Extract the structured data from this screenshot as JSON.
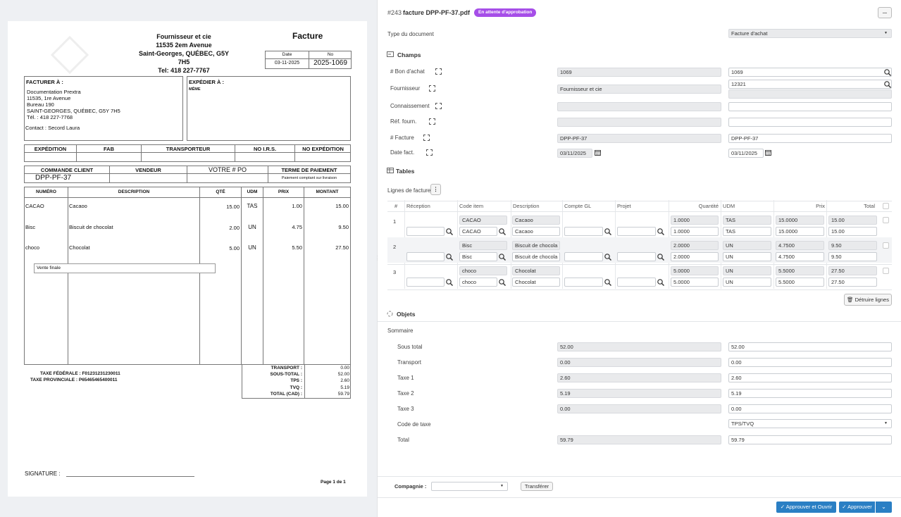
{
  "pdf": {
    "supplier": {
      "name": "Fournisseur et cie",
      "address": "11535 2em Avenue",
      "city": "Saint-Georges, QUÉBEC, G5Y 7H5",
      "phone": "Tel: 418 227-7767"
    },
    "title": "Facture",
    "date_label": "Date",
    "no_label": "No",
    "date": "03-11-2025",
    "no": "2025-1069",
    "bill_to_label": "FACTURER À :",
    "bill_to": [
      "Documentation Prextra",
      "11535, 1re Avenue",
      "Bureau 190",
      "SAINT-GEORGES, QUÉBEC, G5Y 7H5",
      "Tél. : 418 227-7768"
    ],
    "contact": "Contact : Secord Laura",
    "ship_to_label": "EXPÉDIER À :",
    "ship_to": "MÊME",
    "row1_headers": [
      "EXPÉDITION",
      "FAB",
      "TRANSPORTEUR",
      "NO I.R.S.",
      "NO EXPÉDITION"
    ],
    "row2_headers": [
      "COMMANDE CLIENT",
      "VENDEUR",
      "VOTRE # PO",
      "TERME DE PAIEMENT"
    ],
    "client_order": "DPP-PF-37",
    "payment_term": "Paiement comptant sur livraison",
    "item_headers": [
      "NUMÉRO",
      "DESCRIPTION",
      "QTÉ",
      "UDM",
      "PRIX",
      "MONTANT"
    ],
    "items": [
      {
        "num": "CACAO",
        "desc": "Cacaoo",
        "qty": "15.00",
        "udm": "TAS",
        "price": "1.00",
        "amount": "15.00"
      },
      {
        "num": "Bisc",
        "desc": "Biscuit de chocolat",
        "qty": "2.00",
        "udm": "UN",
        "price": "4.75",
        "amount": "9.50"
      },
      {
        "num": "choco",
        "desc": "Chocolat",
        "qty": "5.00",
        "udm": "UN",
        "price": "5.50",
        "amount": "27.50"
      }
    ],
    "vente_finale": "Vente finale",
    "tax_fed": "TAXE FÉDÉRALE : F01231231230011",
    "tax_prov": "TAXE PROVINCIALE : P65465465400011",
    "totals_labels": [
      "TRANSPORT :",
      "SOUS-TOTAL :",
      "TPS :",
      "TVQ :",
      "TOTAL (CAD) :"
    ],
    "totals_values": [
      "0.00",
      "52.00",
      "2.60",
      "5.19",
      "59.79"
    ],
    "signature": "SIGNATURE :",
    "page": "Page 1 de 1"
  },
  "doc": {
    "id": "#243",
    "filename": "facture DPP-PF-37.pdf",
    "status": "En attente d'approbation",
    "more": "..."
  },
  "type_label": "Type du document",
  "type_value": "Facture d'achat",
  "champs_title": "Champs",
  "fields": [
    {
      "label": "# Bon d'achat",
      "ro": "1069",
      "val": "1069"
    },
    {
      "label": "Fournisseur",
      "ro": "Fournisseur et cie",
      "val": "12321"
    },
    {
      "label": "Connaissement",
      "ro": "",
      "val": ""
    },
    {
      "label": "Réf. fourn.",
      "ro": "",
      "val": ""
    },
    {
      "label": "# Facture",
      "ro": "DPP-PF-37",
      "val": "DPP-PF-37"
    },
    {
      "label": "Date fact.",
      "ro": "03/11/2025",
      "val": "03/11/2025"
    }
  ],
  "tables_title": "Tables",
  "lines_title": "Lignes de facture",
  "line_headers": [
    "#",
    "Réception",
    "Code item",
    "Description",
    "Compte GL",
    "Projet",
    "Quantité",
    "UDM",
    "Prix",
    "Total"
  ],
  "lines": [
    {
      "n": "1",
      "code": "CACAO",
      "desc": "Cacaoo",
      "qty": "1.0000",
      "udm": "TAS",
      "price": "15.0000",
      "total": "15.00"
    },
    {
      "n": "2",
      "code": "Bisc",
      "desc": "Biscuit de chocola",
      "qty": "2.0000",
      "udm": "UN",
      "price": "4.7500",
      "total": "9.50"
    },
    {
      "n": "3",
      "code": "choco",
      "desc": "Chocolat",
      "qty": "5.0000",
      "udm": "UN",
      "price": "5.5000",
      "total": "27.50"
    }
  ],
  "delete_lines": "Détruire lignes",
  "objets_title": "Objets",
  "sommaire_title": "Sommaire",
  "summary": [
    {
      "label": "Sous total",
      "ro": "52.00",
      "val": "52.00"
    },
    {
      "label": "Transport",
      "ro": "0.00",
      "val": "0.00"
    },
    {
      "label": "Taxe 1",
      "ro": "2.60",
      "val": "2.60"
    },
    {
      "label": "Taxe 2",
      "ro": "5.19",
      "val": "5.19"
    },
    {
      "label": "Taxe 3",
      "ro": "0.00",
      "val": "0.00"
    }
  ],
  "tax_code_label": "Code de taxe",
  "tax_code_value": "TPS/TVQ",
  "total_label": "Total",
  "total_ro": "59.79",
  "total_val": "59.79",
  "company_label": "Compagnie :",
  "company_value": "",
  "transfer": "Transférer",
  "approve_open": "Approuver et Ouvrir",
  "approve": "Approuver",
  "colors": {
    "accent": "#2a7fc4",
    "badge": "#a64ee8"
  }
}
